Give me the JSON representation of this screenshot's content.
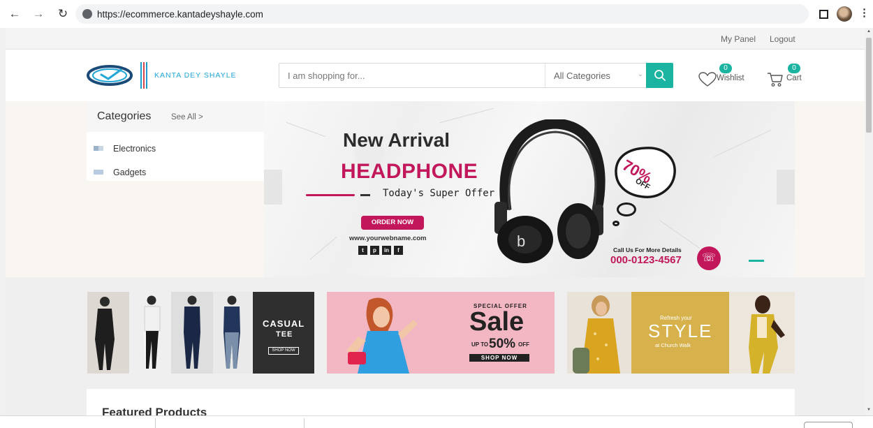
{
  "browser": {
    "url": "https://ecommerce.kantadeyshayle.com"
  },
  "topbar": {
    "panel_label": "My Panel",
    "logout_label": "Logout"
  },
  "header": {
    "logo_text": "KANTA DEY SHAYLE",
    "search_placeholder": "I am shopping for...",
    "category_selected": "All Categories",
    "wishlist_label": "Wishlist",
    "wishlist_count": "0",
    "cart_label": "Cart",
    "cart_count": "0"
  },
  "categories": {
    "title": "Categories",
    "see_all": "See All >",
    "items": [
      {
        "label": "Electronics"
      },
      {
        "label": "Gadgets"
      }
    ]
  },
  "slider": {
    "title": "New Arrival",
    "product": "HEADPHONE",
    "tagline": "Today's Super Offer",
    "cta": "ORDER NOW",
    "website": "www.yourwebname.com",
    "offer_percent": "70%",
    "offer_off": "OFF",
    "call_label": "Call Us For More Details",
    "call_number": "000-0123-4567"
  },
  "promos": [
    {
      "line1": "CASUAL",
      "line2": "TEE",
      "cta": "SHOP NOW"
    },
    {
      "kicker": "SPECIAL OFFER",
      "headline": "Sale",
      "upto": "UP TO",
      "percent": "50%",
      "off": "OFF",
      "cta": "SHOP NOW"
    },
    {
      "kicker": "Refresh your",
      "headline": "STYLE",
      "subline": "at Church Walk"
    }
  ],
  "featured": {
    "title": "Featured Products"
  },
  "colors": {
    "accent": "#1ab4a0",
    "brand": "#21a6d7",
    "promo_pink": "#c2185b"
  }
}
